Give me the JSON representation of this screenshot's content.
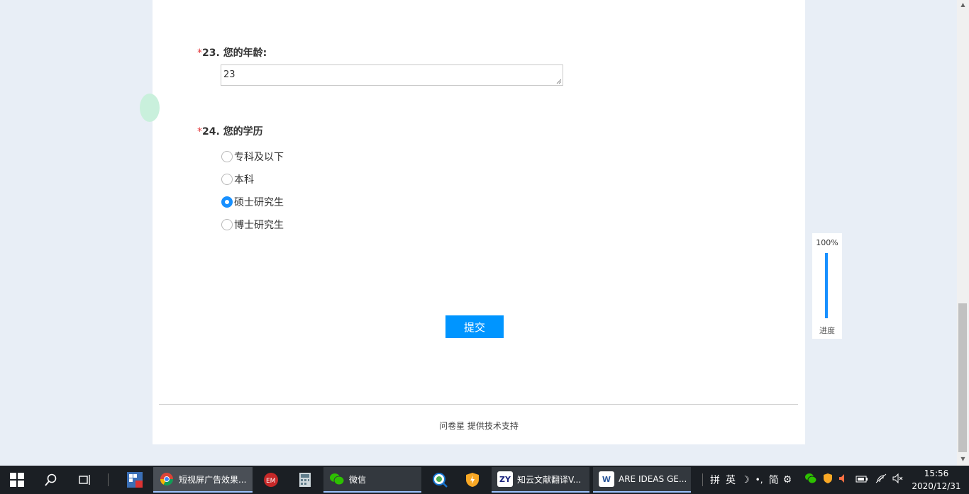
{
  "survey": {
    "q23": {
      "required_mark": "*",
      "number": "23.",
      "title": "您的年龄:",
      "answer": "23"
    },
    "q24": {
      "required_mark": "*",
      "number": "24.",
      "title": "您的学历",
      "options": [
        {
          "label": "专科及以下",
          "checked": false
        },
        {
          "label": "本科",
          "checked": false
        },
        {
          "label": "硕士研究生",
          "checked": true
        },
        {
          "label": "博士研究生",
          "checked": false
        }
      ]
    },
    "submit_label": "提交",
    "footer": "问卷星 提供技术支持"
  },
  "progress": {
    "percent_text": "100%",
    "value": 1.0,
    "label": "进度"
  },
  "taskbar": {
    "apps": [
      {
        "label": "短视屏广告效果...",
        "icon": "chrome-icon",
        "state": "active"
      },
      {
        "label": "微信",
        "icon": "wechat-icon",
        "state": "open"
      },
      {
        "label": "知云文献翻译V...",
        "icon": "zhiyun-icon",
        "state": "open",
        "badge": "ZY"
      },
      {
        "label": "ARE IDEAS GE...",
        "icon": "word-icon",
        "state": "open",
        "badge": "W"
      }
    ],
    "tray": {
      "ime_layout": "拼",
      "ime_lang": "英",
      "ime_mode": "简"
    },
    "clock": {
      "time": "15:56",
      "date": "2020/12/31"
    }
  },
  "colors": {
    "accent": "#0095ff",
    "required": "#e4393c",
    "taskbar": "#1b1f24"
  }
}
